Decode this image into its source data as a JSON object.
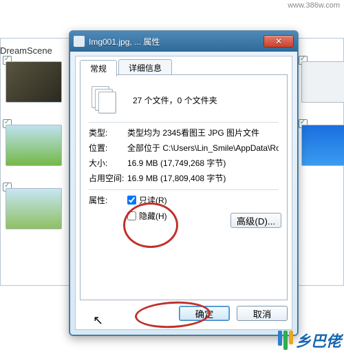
{
  "breadcrumb": "DreamScene",
  "dialog": {
    "title": "Img001.jpg, ... 属性",
    "tabs": {
      "general": "常规",
      "details": "详细信息"
    },
    "summary": "27 个文件，0 个文件夹",
    "rows": {
      "type_label": "类型:",
      "type_value": "类型均为 2345看图王 JPG 图片文件",
      "loc_label": "位置:",
      "loc_value": "全部位于 C:\\Users\\Lin_Smile\\AppData\\Roami",
      "size_label": "大小:",
      "size_value": "16.9 MB (17,749,268 字节)",
      "disk_label": "占用空间:",
      "disk_value": "16.9 MB (17,809,408 字节)"
    },
    "attrs": {
      "label": "属性:",
      "readonly": "只读(R)",
      "hidden": "隐藏(H)"
    },
    "advanced": "高级(D)...",
    "ok": "确定",
    "cancel": "取消"
  },
  "branding": {
    "text": "乡巴佬",
    "url": "www.386w.com"
  }
}
